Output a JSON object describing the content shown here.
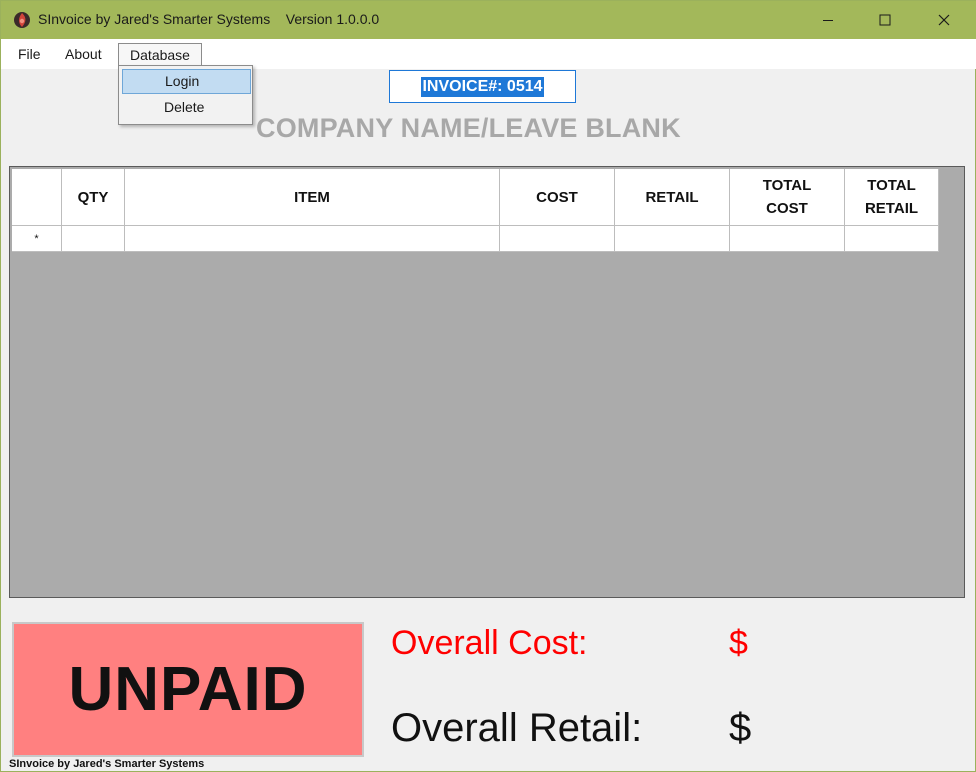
{
  "window": {
    "title": "SInvoice by Jared's Smarter Systems    Version 1.0.0.0",
    "titlebar_color": "#a3b85a"
  },
  "menu": {
    "file": "File",
    "about": "About",
    "database": "Database",
    "dropdown": {
      "login": "Login",
      "delete": "Delete"
    }
  },
  "invoice": {
    "label": "INVOICE#: 0514"
  },
  "company": {
    "placeholder": "COMPANY NAME/LEAVE BLANK"
  },
  "grid": {
    "columns": [
      "",
      "QTY",
      "ITEM",
      "COST",
      "RETAIL",
      "TOTAL\nCOST",
      "TOTAL\nRETAIL"
    ],
    "new_row_marker": "*"
  },
  "summary": {
    "status": "UNPAID",
    "status_color": "#ff8080",
    "overall_cost_label": "Overall Cost:",
    "overall_cost_value": "$",
    "overall_retail_label": "Overall Retail:",
    "overall_retail_value": "$",
    "cost_color": "#ff0000"
  },
  "footer": {
    "text": "SInvoice by Jared's Smarter Systems"
  }
}
